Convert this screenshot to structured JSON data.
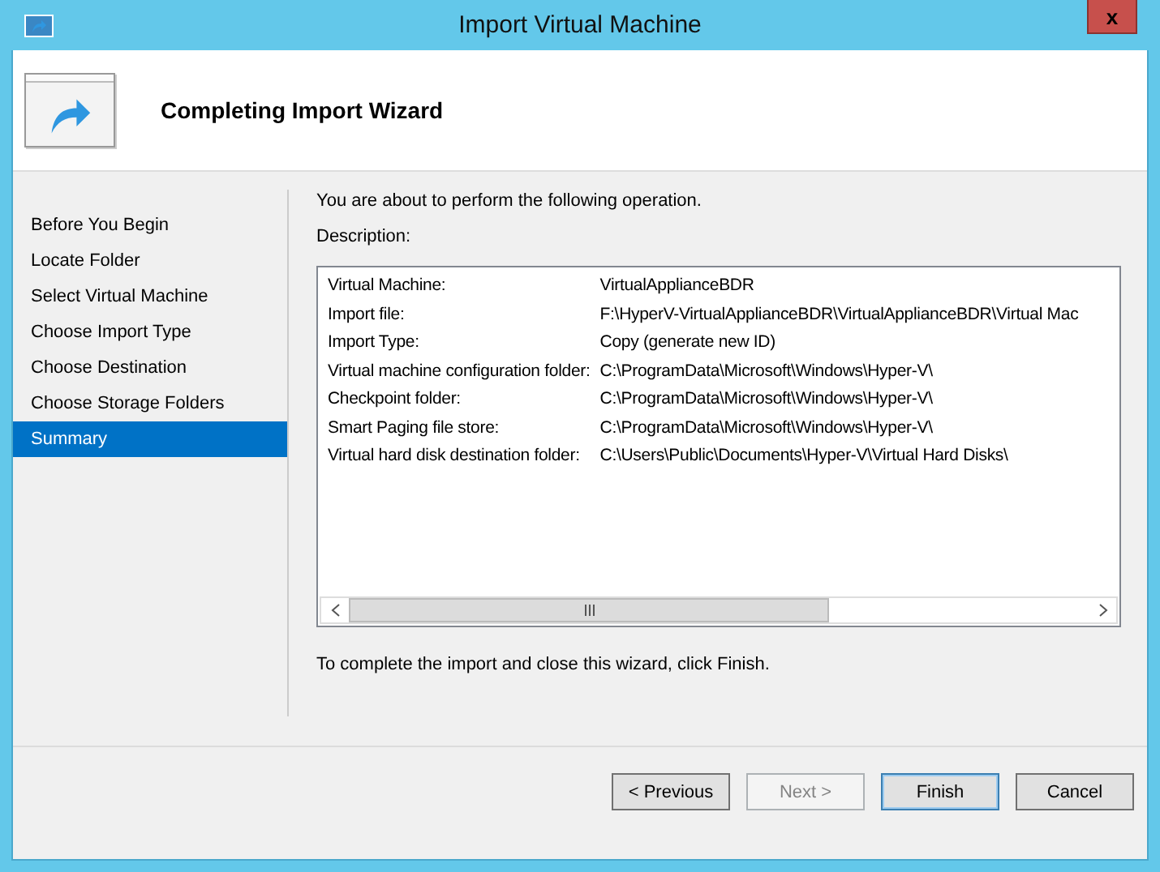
{
  "window": {
    "title": "Import Virtual Machine",
    "close_label": "x"
  },
  "header": {
    "title": "Completing Import Wizard"
  },
  "steps": [
    {
      "label": "Before You Begin",
      "selected": false
    },
    {
      "label": "Locate Folder",
      "selected": false
    },
    {
      "label": "Select Virtual Machine",
      "selected": false
    },
    {
      "label": "Choose Import Type",
      "selected": false
    },
    {
      "label": "Choose Destination",
      "selected": false
    },
    {
      "label": "Choose Storage Folders",
      "selected": false
    },
    {
      "label": "Summary",
      "selected": true
    }
  ],
  "intro": "You are about to perform the following operation.",
  "description_label": "Description:",
  "summary": [
    {
      "label": "Virtual Machine:",
      "value": "VirtualApplianceBDR"
    },
    {
      "label": "Import file:",
      "value": "F:\\HyperV-VirtualApplianceBDR\\VirtualApplianceBDR\\Virtual Mac"
    },
    {
      "label": "Import Type:",
      "value": "Copy (generate new ID)"
    },
    {
      "label": "Virtual machine configuration folder:",
      "value": "C:\\ProgramData\\Microsoft\\Windows\\Hyper-V\\"
    },
    {
      "label": "Checkpoint folder:",
      "value": "C:\\ProgramData\\Microsoft\\Windows\\Hyper-V\\"
    },
    {
      "label": "Smart Paging file store:",
      "value": "C:\\ProgramData\\Microsoft\\Windows\\Hyper-V\\"
    },
    {
      "label": "Virtual hard disk destination folder:",
      "value": "C:\\Users\\Public\\Documents\\Hyper-V\\Virtual Hard Disks\\"
    }
  ],
  "finish_note": "To complete the import and close this wizard, click Finish.",
  "buttons": [
    {
      "label": "< Previous",
      "disabled": false,
      "default": false
    },
    {
      "label": "Next >",
      "disabled": true,
      "default": false
    },
    {
      "label": "Finish",
      "disabled": false,
      "default": true
    },
    {
      "label": "Cancel",
      "disabled": false,
      "default": false
    }
  ]
}
